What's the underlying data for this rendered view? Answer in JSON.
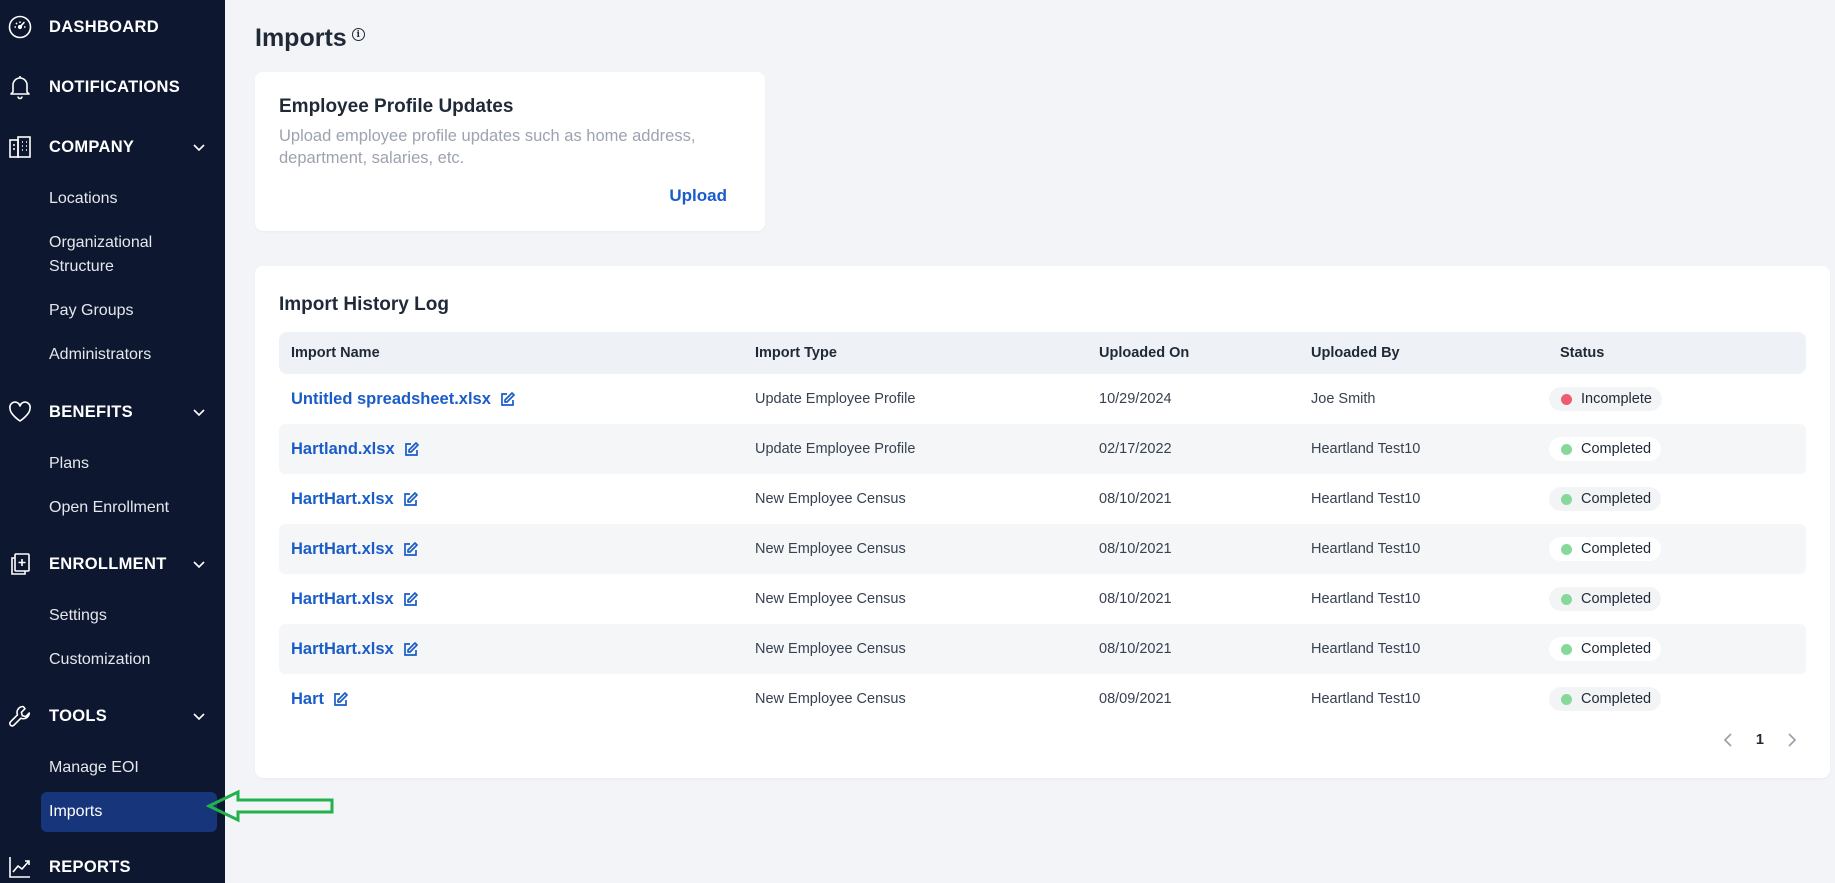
{
  "sidebar": {
    "sections": [
      {
        "label": "DASHBOARD",
        "icon": "dashboard-icon",
        "expandable": false
      },
      {
        "label": "NOTIFICATIONS",
        "icon": "bell-icon",
        "expandable": false
      },
      {
        "label": "COMPANY",
        "icon": "building-icon",
        "expandable": true,
        "items": [
          "Locations",
          "Organizational Structure",
          "Pay Groups",
          "Administrators"
        ]
      },
      {
        "label": "BENEFITS",
        "icon": "heart-icon",
        "expandable": true,
        "items": [
          "Plans",
          "Open Enrollment"
        ]
      },
      {
        "label": "ENROLLMENT",
        "icon": "enrollment-icon",
        "expandable": true,
        "items": [
          "Settings",
          "Customization"
        ]
      },
      {
        "label": "TOOLS",
        "icon": "wrench-icon",
        "expandable": true,
        "items": [
          "Manage EOI",
          "Imports"
        ]
      },
      {
        "label": "REPORTS",
        "icon": "chart-line-icon",
        "expandable": false
      }
    ],
    "active_item": "Imports"
  },
  "page": {
    "title": "Imports",
    "info_icon": "i"
  },
  "upload_card": {
    "title": "Employee Profile Updates",
    "description": "Upload employee profile updates such as home address, department, salaries, etc.",
    "upload_label": "Upload"
  },
  "history": {
    "title": "Import History Log",
    "columns": [
      "Import Name",
      "Import Type",
      "Uploaded On",
      "Uploaded By",
      "Status"
    ],
    "rows": [
      {
        "name": "Untitled spreadsheet.xlsx",
        "type": "Update Employee Profile",
        "date": "10/29/2024",
        "by": "Joe Smith",
        "status": "Incomplete"
      },
      {
        "name": "Hartland.xlsx",
        "type": "Update Employee Profile",
        "date": "02/17/2022",
        "by": "Heartland Test10",
        "status": "Completed"
      },
      {
        "name": "HartHart.xlsx",
        "type": "New Employee Census",
        "date": "08/10/2021",
        "by": "Heartland Test10",
        "status": "Completed"
      },
      {
        "name": "HartHart.xlsx",
        "type": "New Employee Census",
        "date": "08/10/2021",
        "by": "Heartland Test10",
        "status": "Completed"
      },
      {
        "name": "HartHart.xlsx",
        "type": "New Employee Census",
        "date": "08/10/2021",
        "by": "Heartland Test10",
        "status": "Completed"
      },
      {
        "name": "HartHart.xlsx",
        "type": "New Employee Census",
        "date": "08/10/2021",
        "by": "Heartland Test10",
        "status": "Completed"
      },
      {
        "name": "Hart",
        "type": "New Employee Census",
        "date": "08/09/2021",
        "by": "Heartland Test10",
        "status": "Completed"
      }
    ],
    "pagination": {
      "current_page": "1"
    }
  },
  "colors": {
    "sidebar_bg": "#0d1730",
    "active_item_bg": "#17357a",
    "link_blue": "#1a5cc8",
    "status_incomplete": "#ef5b72",
    "status_completed": "#86d99a",
    "annotation_arrow": "#22b14c"
  }
}
